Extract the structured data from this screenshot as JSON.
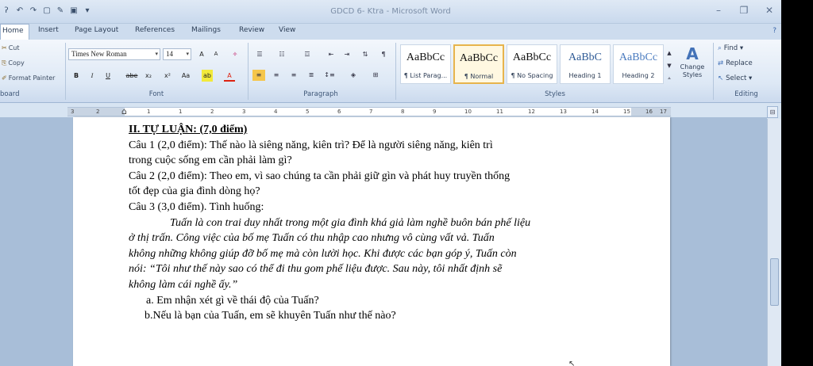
{
  "window": {
    "title": "GDCD 6- Ktra - Microsoft Word",
    "qat_icons": [
      "word-menu-icon",
      "undo-icon",
      "redo-icon",
      "print-preview-icon",
      "edit-icon",
      "save-icon",
      "customize-icon"
    ],
    "controls": [
      "minimize-icon",
      "restore-icon",
      "close-icon"
    ]
  },
  "tabs": [
    {
      "label": "Home",
      "active": true
    },
    {
      "label": "Insert"
    },
    {
      "label": "Page Layout"
    },
    {
      "label": "References"
    },
    {
      "label": "Mailings"
    },
    {
      "label": "Review"
    },
    {
      "label": "View"
    }
  ],
  "ribbon": {
    "clipboard": {
      "cut": "Cut",
      "copy": "Copy",
      "format_painter": "Format Painter",
      "label": "board"
    },
    "font": {
      "name": "Times New Roman",
      "size": "14",
      "grow": "A",
      "shrink": "A",
      "bold": "B",
      "italic": "I",
      "underline": "U",
      "strike": "abe",
      "subscript": "x₂",
      "superscript": "x²",
      "change_case": "Aa",
      "font_color": "A",
      "label": "Font"
    },
    "paragraph": {
      "label": "Paragraph"
    },
    "styles": {
      "label": "Styles",
      "items": [
        {
          "sample": "AaBbCc",
          "name": "¶ List Parag..."
        },
        {
          "sample": "AaBbCc",
          "name": "¶ Normal",
          "selected": true
        },
        {
          "sample": "AaBbCc",
          "name": "¶ No Spacing"
        },
        {
          "sample": "AaBbC",
          "name": "Heading 1"
        },
        {
          "sample": "AaBbCc",
          "name": "Heading 2"
        }
      ],
      "change_styles": "Change Styles"
    },
    "editing": {
      "find": "Find",
      "replace": "Replace",
      "select": "Select",
      "label": "Editing"
    }
  },
  "ruler": {
    "ticks": [
      "3",
      "2",
      "1",
      "1",
      "2",
      "3",
      "4",
      "5",
      "6",
      "7",
      "8",
      "9",
      "10",
      "11",
      "12",
      "13",
      "14",
      "15",
      "16",
      "17"
    ]
  },
  "document": {
    "lines": [
      {
        "text": "II. TỰ LUẬN:  (7,0 điểm)",
        "style": "heading"
      },
      {
        "text": "Câu 1 (2,0 điểm): Thế nào là siêng năng, kiên trì? Để là người siêng năng, kiên trì"
      },
      {
        "text": "trong cuộc sống em cần phải làm gì?"
      },
      {
        "text": "Câu 2 (2,0 điểm): Theo em, vì sao chúng ta cần phải giữ gìn và phát huy truyền thống"
      },
      {
        "text": "tốt đẹp của gia đình dòng họ?"
      },
      {
        "text": "Câu 3 (3,0 điểm). Tình huống:"
      },
      {
        "text": "Tuấn là con trai duy nhất trong một gia đình khá giả làm nghề buôn bán phế liệu",
        "style": "italic indent1"
      },
      {
        "text": "ở thị trấn. Công việc của bố mẹ Tuấn có thu nhập cao nhưng vô cùng vất vả. Tuấn",
        "style": "italic"
      },
      {
        "text": "không những không giúp đỡ bố mẹ mà còn lười học. Khi được các bạn góp ý, Tuấn còn",
        "style": "italic"
      },
      {
        "text": "nói: “Tôi như thế này sao có thể đi thu gom phế liệu được. Sau này, tôi nhất định sẽ",
        "style": "italic"
      },
      {
        "text": "không làm cái nghề ấy.”",
        "style": "italic"
      },
      {
        "text": "a. Em nhận xét gì về thái độ của Tuấn?",
        "style": "indent2"
      },
      {
        "text": "b.Nếu là bạn của Tuấn, em sẽ khuyên Tuấn như thế nào?",
        "style": "indent2b"
      }
    ]
  },
  "colors": {
    "ribbon_bg": "#dde8f5",
    "doc_bg": "#a8bed8",
    "selected_style": "#e7b44c",
    "accent": "#4372b8"
  }
}
